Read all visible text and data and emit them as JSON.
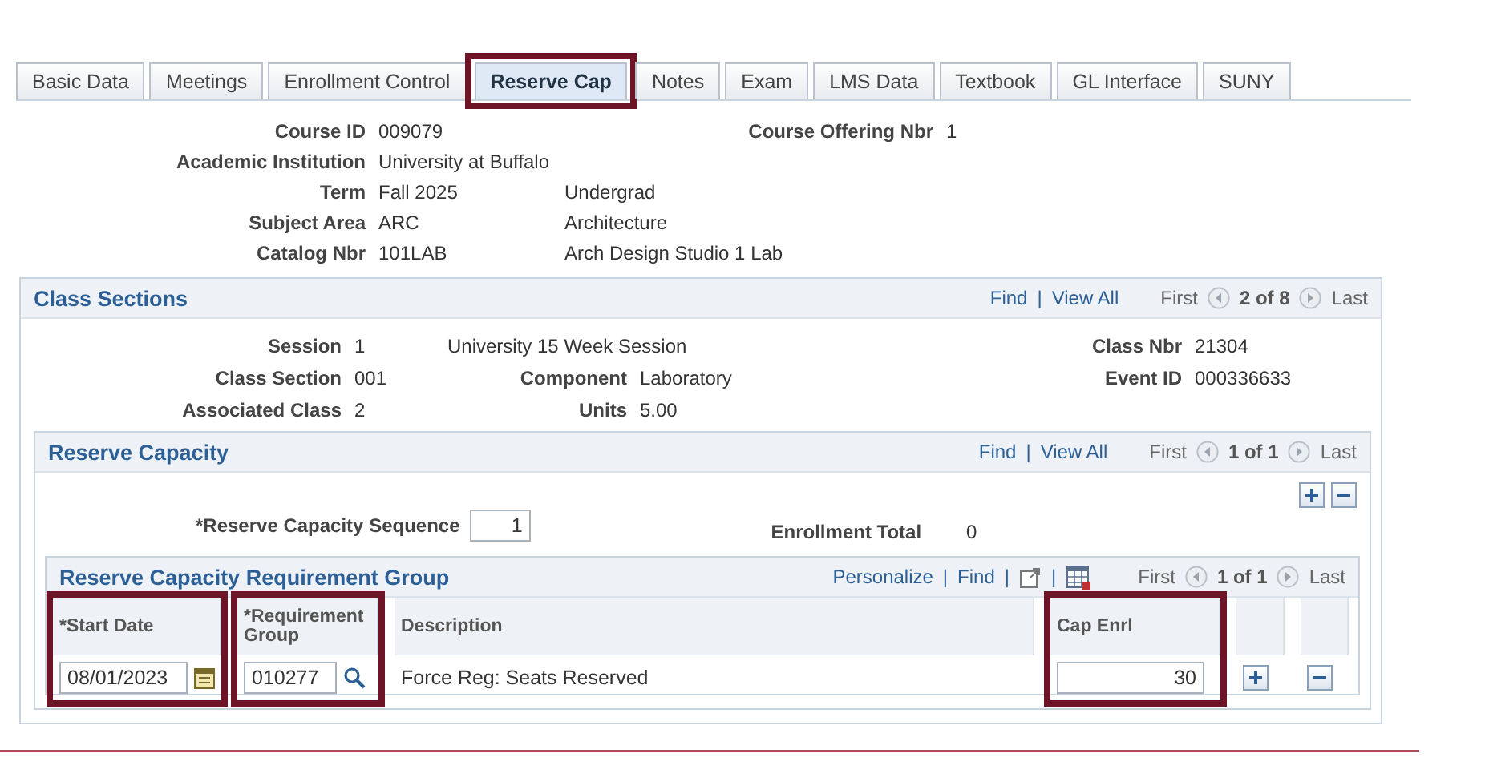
{
  "tabs": [
    {
      "label": "Basic Data",
      "selected": false,
      "highlighted": false
    },
    {
      "label": "Meetings",
      "selected": false,
      "highlighted": false
    },
    {
      "label": "Enrollment Control",
      "selected": false,
      "highlighted": false
    },
    {
      "label": "Reserve Cap",
      "selected": true,
      "highlighted": true
    },
    {
      "label": "Notes",
      "selected": false,
      "highlighted": false
    },
    {
      "label": "Exam",
      "selected": false,
      "highlighted": false
    },
    {
      "label": "LMS Data",
      "selected": false,
      "highlighted": false
    },
    {
      "label": "Textbook",
      "selected": false,
      "highlighted": false
    },
    {
      "label": "GL Interface",
      "selected": false,
      "highlighted": false
    },
    {
      "label": "SUNY",
      "selected": false,
      "highlighted": false
    }
  ],
  "course": [
    {
      "label": "Course ID",
      "value": "009079",
      "extra_label": "Course Offering Nbr",
      "extra_value": "1"
    },
    {
      "label": "Academic Institution",
      "value": "University at Buffalo"
    },
    {
      "label": "Term",
      "value": "Fall 2025",
      "description": "Undergrad"
    },
    {
      "label": "Subject Area",
      "value": "ARC",
      "description": "Architecture"
    },
    {
      "label": "Catalog Nbr",
      "value": "101LAB",
      "description": "Arch Design Studio 1 Lab"
    }
  ],
  "class_sections": {
    "title": "Class Sections",
    "nav": {
      "find": "Find",
      "separator": "|",
      "view_all": "View All",
      "first": "First",
      "position": "2 of 8",
      "last": "Last"
    },
    "rows": [
      {
        "left": {
          "label": "Session",
          "value": "1"
        },
        "middle": {
          "value": "University 15 Week Session"
        },
        "right": {
          "label": "Class Nbr",
          "value": "21304"
        }
      },
      {
        "left": {
          "label": "Class Section",
          "value": "001"
        },
        "middle": {
          "label": "Component",
          "value": "Laboratory"
        },
        "right": {
          "label": "Event ID",
          "value": "000336633"
        }
      },
      {
        "left": {
          "label": "Associated Class",
          "value": "2"
        },
        "middle": {
          "label": "Units",
          "value": "5.00"
        }
      }
    ]
  },
  "reserve_capacity": {
    "title": "Reserve Capacity",
    "nav": {
      "find": "Find",
      "separator": "|",
      "view_all": "View All",
      "first": "First",
      "position": "1 of 1",
      "last": "Last"
    },
    "sequence": {
      "label": "*Reserve Capacity Sequence",
      "value": "1"
    },
    "enrollment_total": {
      "label": "Enrollment Total",
      "value": "0"
    },
    "requirement_group": {
      "title": "Reserve Capacity Requirement Group",
      "nav": {
        "personalize": "Personalize",
        "separators": [
          "|",
          "|",
          "|"
        ],
        "find": "Find",
        "first": "First",
        "position": "1 of 1",
        "last": "Last"
      },
      "columns": [
        {
          "kind": "date",
          "header": "*Start Date",
          "value": "08/01/2023",
          "highlighted": true
        },
        {
          "kind": "lookup",
          "header": "*Requirement Group",
          "value": "010277",
          "highlighted": true
        },
        {
          "kind": "text",
          "header": "Description",
          "value": "Force Reg: Seats Reserved",
          "highlighted": false
        },
        {
          "kind": "number",
          "header": "Cap Enrl",
          "value": "30",
          "highlighted": true
        },
        {
          "kind": "add",
          "highlighted": false
        },
        {
          "kind": "remove",
          "highlighted": false
        }
      ]
    }
  }
}
